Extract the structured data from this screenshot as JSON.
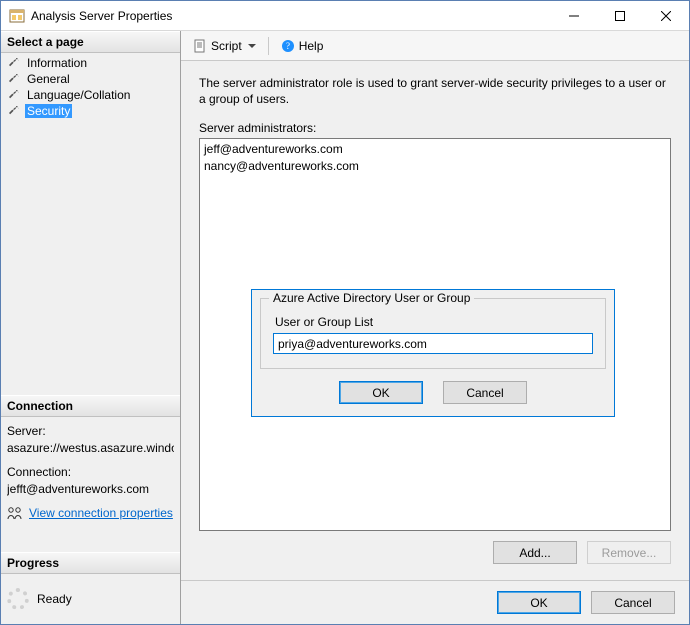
{
  "window": {
    "title": "Analysis Server Properties"
  },
  "sidebar": {
    "select_page_header": "Select a page",
    "items": [
      {
        "label": "Information"
      },
      {
        "label": "General"
      },
      {
        "label": "Language/Collation"
      },
      {
        "label": "Security"
      }
    ],
    "selected_index": 3,
    "connection_header": "Connection",
    "server_label": "Server:",
    "server_value": "asazure://westus.asazure.windows",
    "connection_label": "Connection:",
    "connection_value": "jefft@adventureworks.com",
    "view_connection_link": "View connection properties",
    "progress_header": "Progress",
    "progress_status": "Ready"
  },
  "toolbar": {
    "script_label": "Script",
    "help_label": "Help"
  },
  "main": {
    "description": "The server administrator role is used to grant server-wide security privileges to a user or a group of users.",
    "admins_label": "Server administrators:",
    "admins": [
      "jeff@adventureworks.com",
      "nancy@adventureworks.com"
    ],
    "add_label": "Add...",
    "remove_label": "Remove..."
  },
  "dialog": {
    "group_title": "Azure Active Directory User or Group",
    "field_label": "User or Group List",
    "input_value": "priya@adventureworks.com",
    "ok_label": "OK",
    "cancel_label": "Cancel"
  },
  "footer": {
    "ok_label": "OK",
    "cancel_label": "Cancel"
  }
}
